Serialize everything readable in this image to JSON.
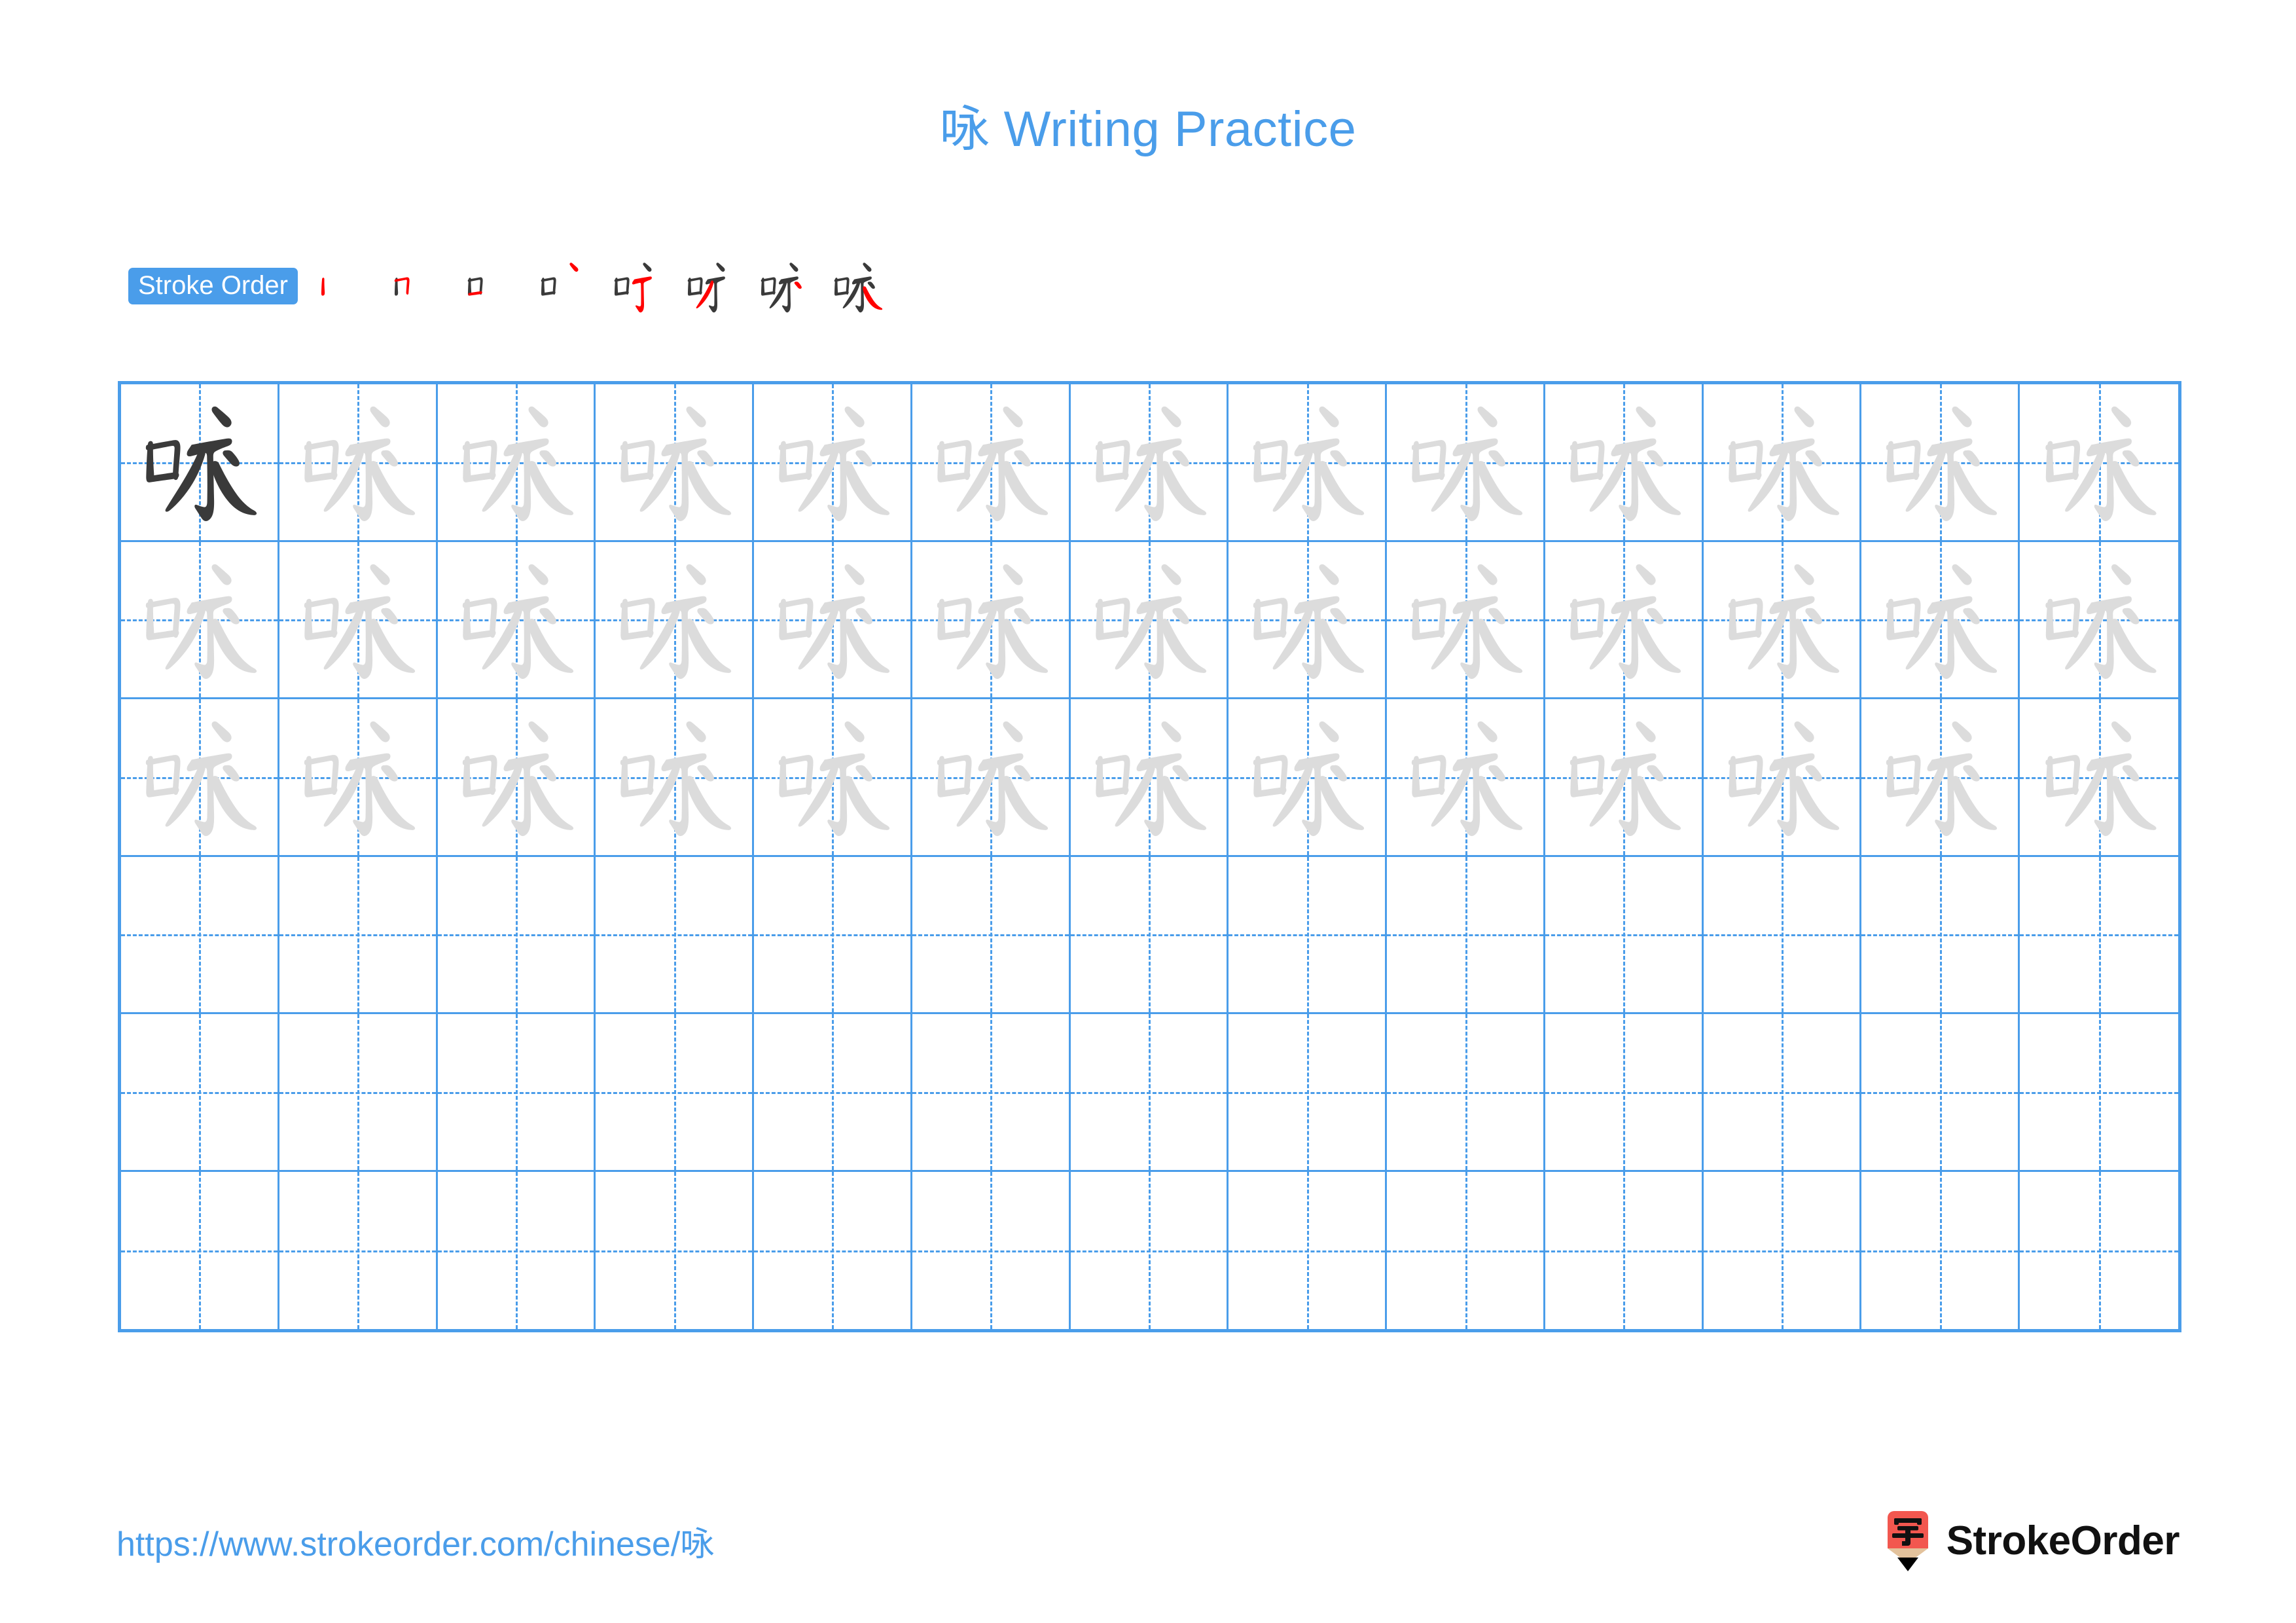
{
  "page": {
    "title": "咏 Writing Practice",
    "character": "咏",
    "accent_color": "#4a9dea",
    "ink_color": "#3a3a3a",
    "new_stroke_color": "#ff0000",
    "trace_color": "#dcdcdc"
  },
  "stroke_order": {
    "label": "Stroke Order",
    "total_strokes": 8,
    "steps": [
      {
        "index": 1,
        "strokes_shown": 1,
        "new_stroke": "丨 (vertical, left of 口)"
      },
      {
        "index": 2,
        "strokes_shown": 2,
        "new_stroke": "𠃍 (horizontal-turn of 口)"
      },
      {
        "index": 3,
        "strokes_shown": 3,
        "new_stroke": "一 (bottom of 口)"
      },
      {
        "index": 4,
        "strokes_shown": 4,
        "new_stroke": "丶 (dot, top of 永)"
      },
      {
        "index": 5,
        "strokes_shown": 5,
        "new_stroke": "㇊ (horizontal hook)"
      },
      {
        "index": 6,
        "strokes_shown": 6,
        "new_stroke": "㇒ (left falling)"
      },
      {
        "index": 7,
        "strokes_shown": 7,
        "new_stroke": "㇇ (short right turn)"
      },
      {
        "index": 8,
        "strokes_shown": 8,
        "new_stroke": "㇏ (right falling)"
      }
    ]
  },
  "grid": {
    "columns": 13,
    "rows": 6,
    "cells": [
      [
        "solid",
        "trace",
        "trace",
        "trace",
        "trace",
        "trace",
        "trace",
        "trace",
        "trace",
        "trace",
        "trace",
        "trace",
        "trace"
      ],
      [
        "trace",
        "trace",
        "trace",
        "trace",
        "trace",
        "trace",
        "trace",
        "trace",
        "trace",
        "trace",
        "trace",
        "trace",
        "trace"
      ],
      [
        "trace",
        "trace",
        "trace",
        "trace",
        "trace",
        "trace",
        "trace",
        "trace",
        "trace",
        "trace",
        "trace",
        "trace",
        "trace"
      ],
      [
        "empty",
        "empty",
        "empty",
        "empty",
        "empty",
        "empty",
        "empty",
        "empty",
        "empty",
        "empty",
        "empty",
        "empty",
        "empty"
      ],
      [
        "empty",
        "empty",
        "empty",
        "empty",
        "empty",
        "empty",
        "empty",
        "empty",
        "empty",
        "empty",
        "empty",
        "empty",
        "empty"
      ],
      [
        "empty",
        "empty",
        "empty",
        "empty",
        "empty",
        "empty",
        "empty",
        "empty",
        "empty",
        "empty",
        "empty",
        "empty",
        "empty"
      ]
    ]
  },
  "footer": {
    "url": "https://www.strokeorder.com/chinese/咏",
    "brand_name": "StrokeOrder",
    "brand_mark_character": "字",
    "brand_mark_body_color": "#f2574f",
    "brand_mark_wood_color": "#e3c29c",
    "brand_mark_tip_color": "#000000"
  }
}
